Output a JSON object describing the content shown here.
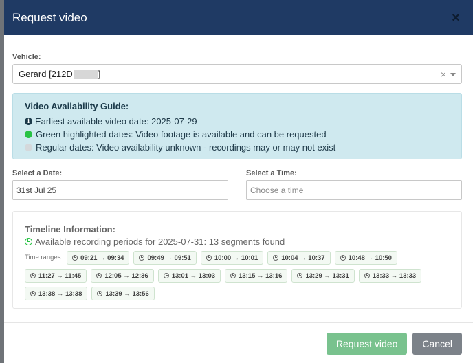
{
  "modal": {
    "title": "Request video",
    "close_symbol": "×"
  },
  "vehicle": {
    "label": "Vehicle:",
    "value": "Gerard  [212D",
    "value_suffix": "]",
    "clear_symbol": "×"
  },
  "guide": {
    "title": "Video Availability Guide:",
    "info_glyph": "i",
    "earliest": "Earliest available video date: 2025-07-29",
    "green": "Green highlighted dates: Video footage is available and can be requested",
    "regular": "Regular dates: Video availability unknown - recordings may or may not exist",
    "colors": {
      "green": "#28c244",
      "grey": "#d4d8db",
      "background": "#cfe9ef"
    }
  },
  "date": {
    "label": "Select a Date:",
    "value": "31st Jul 25"
  },
  "time": {
    "label": "Select a Time:",
    "placeholder": "Choose a time"
  },
  "timeline": {
    "title": "Timeline Information:",
    "summary": "Available recording periods for 2025-07-31: 13 segments found",
    "ranges_label": "Time ranges:",
    "ranges": [
      "09:21 → 09:34",
      "09:49 → 09:51",
      "10:00 → 10:01",
      "10:04 → 10:37",
      "10:48 → 10:50",
      "11:27 → 11:45",
      "12:05 → 12:36",
      "13:01 → 13:03",
      "13:15 → 13:16",
      "13:29 → 13:31",
      "13:33 → 13:33",
      "13:38 → 13:38",
      "13:39 → 13:56"
    ]
  },
  "footer": {
    "request_label": "Request video",
    "cancel_label": "Cancel"
  },
  "icons": {
    "close": "close-icon",
    "info": "info-circle-icon",
    "clock": "clock-icon",
    "caret": "chevron-down-icon"
  },
  "colors": {
    "header": "#1f3a64",
    "primary_button": "#79c28e",
    "secondary_button": "#7c8289"
  }
}
